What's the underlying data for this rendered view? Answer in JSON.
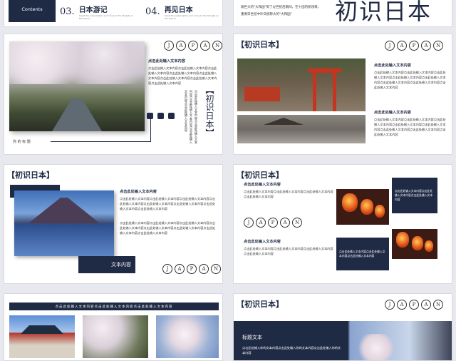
{
  "s1": {
    "contents": "Contents",
    "item3_num": "03.",
    "item3_title": "日本游记",
    "item3_sub": "Insert the subscription and move to the Shopify on the Tiles in",
    "item4_num": "04.",
    "item4_title": "再见日本",
    "item4_sub": "Insert the subscription and move to the Shopify on the Tiles in"
  },
  "s2": {
    "line1": "观世大的\"大和国\"到了过世纪后期间，在十国内统领来，",
    "line2": "重要日世纪中叶日统称大的\"大和国\"",
    "big_title": "初识日本"
  },
  "japan_letters": [
    "J",
    "A",
    "P",
    "A",
    "N"
  ],
  "section_title": "【初识日本】",
  "vertical_title": "【初识日本】",
  "sub_heading": "点击此处输入文本内容",
  "body_text": "点击此处输入文本内容点击此处输入文本内容点击此处输入文本内容点击此处输入文本内容点击此处输入文本内容点击此处输入文本内容点击此处输入文本内容点击此处输入文本内容",
  "body_short": "点击此处输入文本内容点击此处输入文本内容点击此处输入文本内容点击此处输入文本内容",
  "s3": {
    "caption": "你 的 标 题",
    "vertical_text": "点击此处输入文本内容点击此处输入文本内容点击此处输入文本内容点击此处输入文本内容点击此处输入文本内容"
  },
  "s5": {
    "label": "文本内容"
  },
  "s6": {
    "box1": "点击此处输入文本内容点击此处输入文本内容点击此处输入文本内容",
    "box2": "点击此处输入文本内容点击此处输入文本内容点击此处输入文本内容"
  },
  "s7": {
    "banner": "点击此处输入文本内容点击此处输入文本内容点击此处输入文本内容"
  },
  "s8": {
    "label": "标题文本",
    "text": "点击此处输入你的文本内容点击此处输入你的文本内容点击此处输入你的文本内容"
  }
}
